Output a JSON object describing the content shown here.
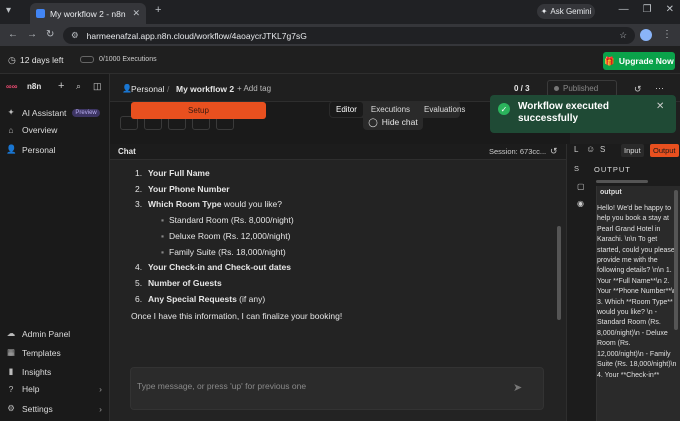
{
  "browser": {
    "tab_title": "My workflow 2 - n8n",
    "gemini_label": "Ask Gemini",
    "url": "harmeenafzal.app.n8n.cloud/workflow/4aoaycrJTKL7g7sG"
  },
  "banner": {
    "trial": "12 days left",
    "executions": "0/1000 Executions",
    "upgrade": "Upgrade Now"
  },
  "sidebar": {
    "logo": "n8n",
    "items": [
      {
        "label": "AI Assistant",
        "icon": "sparkle-icon"
      },
      {
        "label": "Overview",
        "icon": "home-icon"
      },
      {
        "label": "Personal",
        "icon": "user-icon"
      }
    ],
    "preview_badge": "Preview",
    "bottom": [
      {
        "label": "Admin Panel"
      },
      {
        "label": "Templates"
      },
      {
        "label": "Insights"
      },
      {
        "label": "Help"
      },
      {
        "label": "Settings"
      }
    ]
  },
  "header": {
    "project": "Personal",
    "workflow": "My workflow 2",
    "add_tag": "+ Add tag",
    "counter": "0 / 3",
    "published": "Published"
  },
  "canvas": {
    "setup_label": "Setup",
    "tabs": [
      "Editor",
      "Executions",
      "Evaluations"
    ],
    "hide_chat": "Hide chat"
  },
  "toast": {
    "message": "Workflow executed successfully"
  },
  "chat": {
    "title": "Chat",
    "session": "Session: 673cc...",
    "items": [
      {
        "num": "1.",
        "bold": "Your Full Name",
        "rest": ""
      },
      {
        "num": "2.",
        "bold": "Your Phone Number",
        "rest": ""
      },
      {
        "num": "3.",
        "bold": "Which Room Type",
        "rest": " would you like?"
      },
      {
        "num": "4.",
        "bold": "Your Check-in and Check-out dates",
        "rest": ""
      },
      {
        "num": "5.",
        "bold": "Number of Guests",
        "rest": ""
      },
      {
        "num": "6.",
        "bold": "Any Special Requests",
        "rest": " (if any)"
      }
    ],
    "rooms": [
      "Standard Room (Rs. 8,000/night)",
      "Deluxe Room (Rs. 12,000/night)",
      "Family Suite (Rs. 18,000/night)"
    ],
    "closing": "Once I have this information, I can finalize your booking!",
    "placeholder": "Type message, or press 'up' for previous one"
  },
  "right_panel": {
    "input_tab": "Input",
    "output_tab": "Output",
    "s_label": "S",
    "s_label2": "S",
    "l_label": "L",
    "section": "OUTPUT",
    "field": "output",
    "output_text": "Hello! We'd be happy to help you book a stay at Pearl Grand Hotel in Karachi. \\n\\n To get started, could you please provide me with the following details? \\n\\n 1. Your **Full Name**\\n 2. Your **Phone Number**\\n 3. Which **Room Type** would you like? \\n    - Standard Room (Rs. 8,000/night)\\n    - Deluxe Room (Rs. 12,000/night)\\n    - Family Suite (Rs. 18,000/night)\\n 4. Your **Check-in**"
  }
}
